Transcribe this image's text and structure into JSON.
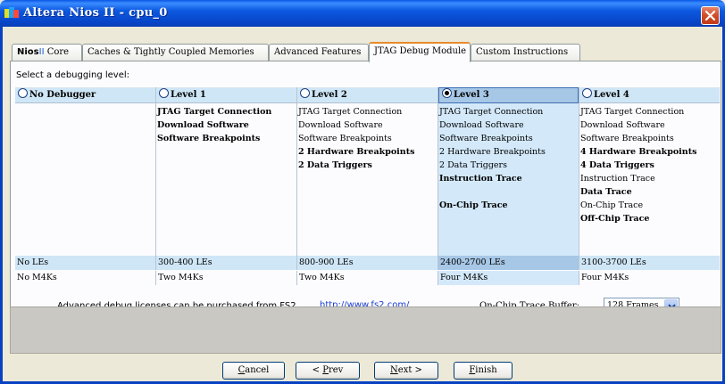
{
  "window": {
    "title": "Altera Nios II - cpu_0",
    "close_label": "Close"
  },
  "tabs": [
    {
      "label_a": "Nios",
      "label_b": "II",
      "label_c": " Core"
    },
    {
      "label": "Caches & Tightly Coupled Memories"
    },
    {
      "label": "Advanced Features"
    },
    {
      "label": "JTAG Debug Module",
      "active": true
    },
    {
      "label": "Custom Instructions"
    }
  ],
  "debug": {
    "prompt": "Select a debugging level:",
    "selected": "Level 3",
    "levels": [
      {
        "name": "No Debugger",
        "les": "No LEs",
        "m4k": "No M4Ks",
        "features": []
      },
      {
        "name": "Level 1",
        "les": "300-400 LEs",
        "m4k": "Two M4Ks",
        "features": [
          {
            "text": "JTAG Target Connection",
            "bold": true
          },
          {
            "text": "Download Software",
            "bold": true
          },
          {
            "text": "Software Breakpoints",
            "bold": true
          }
        ]
      },
      {
        "name": "Level 2",
        "les": "800-900 LEs",
        "m4k": "Two M4Ks",
        "features": [
          {
            "text": "JTAG Target Connection",
            "bold": false
          },
          {
            "text": "Download Software",
            "bold": false
          },
          {
            "text": "Software Breakpoints",
            "bold": false
          },
          {
            "text": "2 Hardware Breakpoints",
            "bold": true
          },
          {
            "text": "2 Data Triggers",
            "bold": true
          }
        ]
      },
      {
        "name": "Level 3",
        "les": "2400-2700 LEs",
        "m4k": "Four M4Ks",
        "features": [
          {
            "text": "JTAG Target Connection",
            "bold": false
          },
          {
            "text": "Download Software",
            "bold": false
          },
          {
            "text": "Software Breakpoints",
            "bold": false
          },
          {
            "text": "2 Hardware Breakpoints",
            "bold": false
          },
          {
            "text": "2 Data Triggers",
            "bold": false
          },
          {
            "text": "Instruction Trace",
            "bold": true
          },
          {
            "text": "",
            "bold": false
          },
          {
            "text": "On-Chip Trace",
            "bold": true
          }
        ]
      },
      {
        "name": "Level 4",
        "les": "3100-3700 LEs",
        "m4k": "Four M4Ks",
        "features": [
          {
            "text": "JTAG Target Connection",
            "bold": false
          },
          {
            "text": "Download Software",
            "bold": false
          },
          {
            "text": "Software Breakpoints",
            "bold": false
          },
          {
            "text": "4 Hardware Breakpoints",
            "bold": true
          },
          {
            "text": "4 Data Triggers",
            "bold": true
          },
          {
            "text": "Instruction Trace",
            "bold": false
          },
          {
            "text": "Data Trace",
            "bold": true
          },
          {
            "text": "On-Chip Trace",
            "bold": false
          },
          {
            "text": "Off-Chip Trace",
            "bold": true
          }
        ]
      }
    ]
  },
  "license": {
    "text": "Advanced debug licenses can be purchased from FS2.",
    "link": "http://www.fs2.com/"
  },
  "trace_buffer": {
    "label": "On-Chip Trace Buffer:",
    "value": "128 Frames"
  },
  "buttons": {
    "cancel": {
      "mnemonic": "C",
      "rest": "ancel"
    },
    "prev": {
      "prefix": "< ",
      "mnemonic": "P",
      "rest": "rev"
    },
    "next": {
      "mnemonic": "N",
      "rest": "ext >"
    },
    "finish": {
      "mnemonic": "F",
      "rest": "inish"
    }
  },
  "colors": {
    "title_bar": "#0a58e6",
    "selected_column": "#d3e9fa",
    "header_row": "#cfe6f6",
    "active_tab_accent": "#e68b2c",
    "link": "#1a3ccf"
  }
}
